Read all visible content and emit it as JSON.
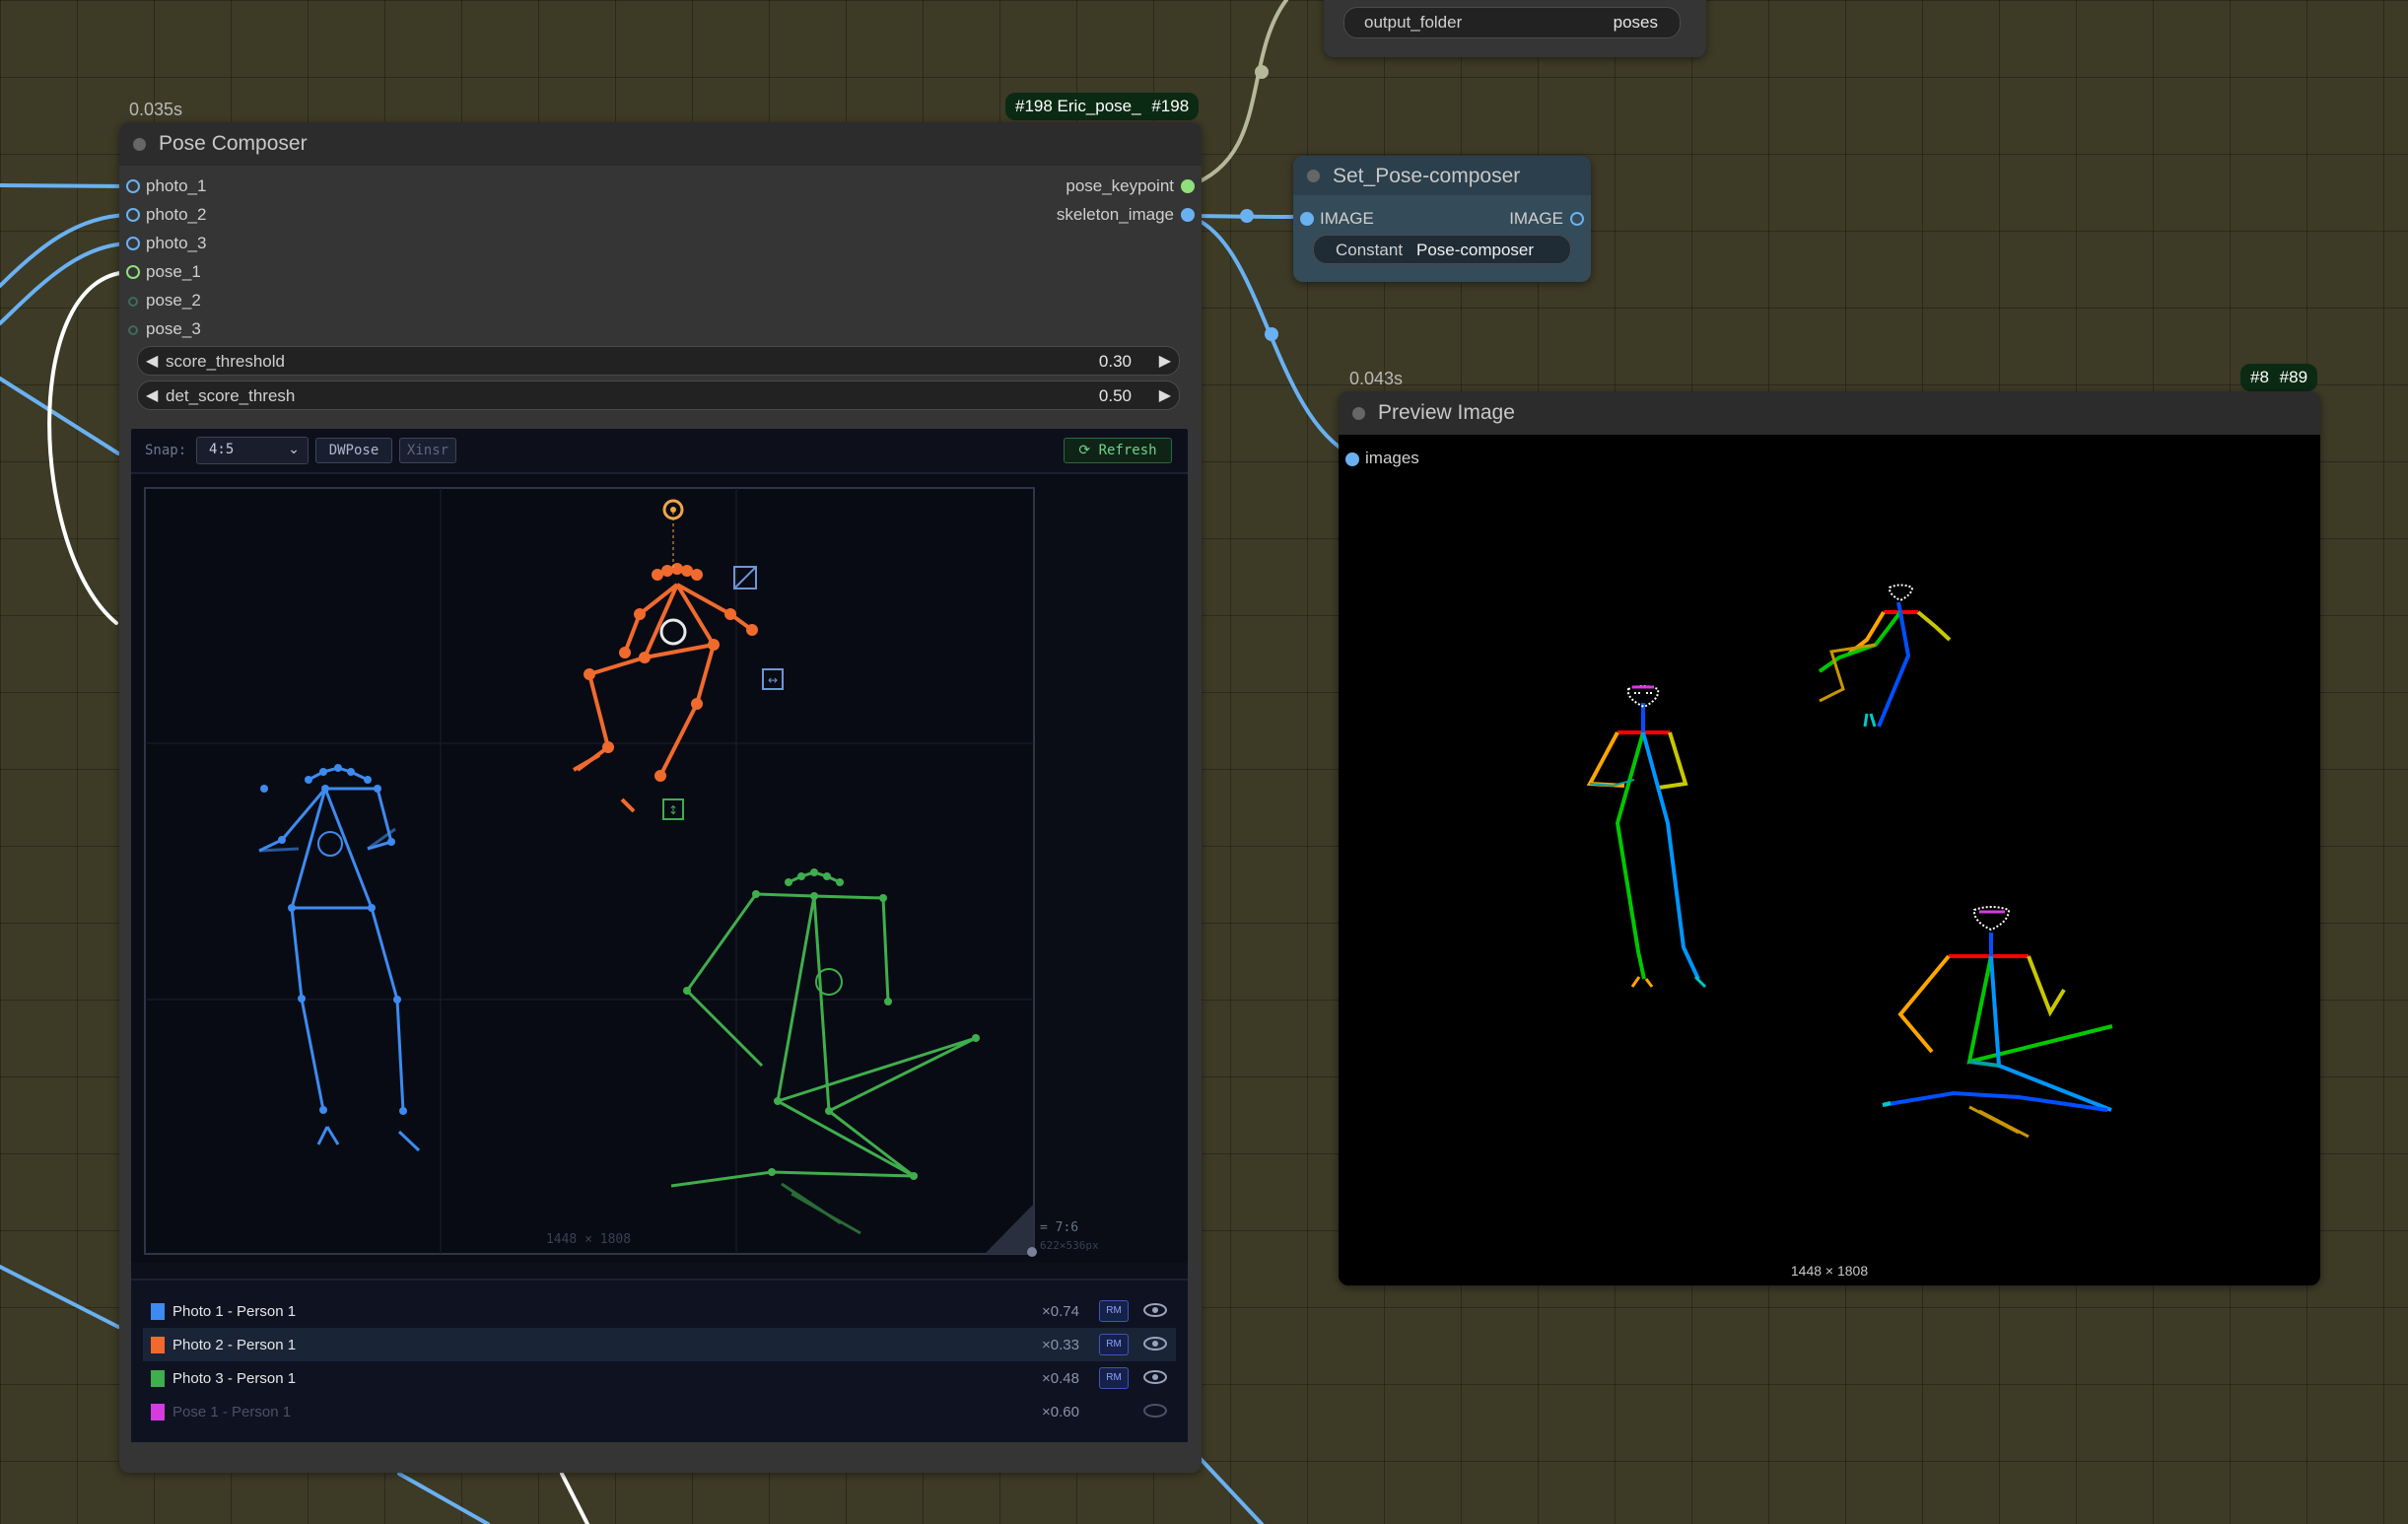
{
  "top_node": {
    "widget_label": "output_folder",
    "widget_value": "poses"
  },
  "pose_composer": {
    "timing": "0.035s",
    "badge_left": "#198 Eric_pose_",
    "badge_right": "#198",
    "title": "Pose Composer",
    "inputs": [
      "photo_1",
      "photo_2",
      "photo_3",
      "pose_1",
      "pose_2",
      "pose_3"
    ],
    "outputs": [
      "pose_keypoint",
      "skeleton_image"
    ],
    "widgets": [
      {
        "label": "score_threshold",
        "value": "0.30"
      },
      {
        "label": "det_score_thresh",
        "value": "0.50"
      }
    ],
    "toolbar": {
      "snap_label": "Snap:",
      "snap_value": "4:5",
      "dwpose_label": "DWPose",
      "xinsr_label": "Xinsr",
      "refresh_label": "⟳ Refresh"
    },
    "canvas": {
      "dimension_label": "1448 × 1808",
      "ratio_label": "= 7:6",
      "size_label": "622×536px"
    },
    "layers": [
      {
        "name": "Photo 1 - Person 1",
        "scale": "×0.74",
        "color": "#3d8bf0",
        "visible": true,
        "rm": "RM"
      },
      {
        "name": "Photo 2 - Person 1",
        "scale": "×0.33",
        "color": "#f06a2e",
        "visible": true,
        "rm": "RM",
        "selected": true
      },
      {
        "name": "Photo 3 - Person 1",
        "scale": "×0.48",
        "color": "#3fae4c",
        "visible": true,
        "rm": "RM"
      },
      {
        "name": "Pose 1 - Person 1",
        "scale": "×0.60",
        "color": "#d63be0",
        "visible": false
      }
    ]
  },
  "set_node": {
    "title": "Set_Pose-composer",
    "input_label": "IMAGE",
    "output_label": "IMAGE",
    "constant_label": "Constant",
    "constant_value": "Pose-composer"
  },
  "preview_node": {
    "timing": "0.043s",
    "badge_left": "#8",
    "badge_right": "#89",
    "title": "Preview Image",
    "input_label": "images",
    "dimension_label": "1448 × 1808"
  },
  "colors": {
    "background": "#3d3a26",
    "node": "#353535",
    "link_blue": "#6ab1f1",
    "link_white": "#ffffff",
    "link_gray": "#b6b89a",
    "canvas_bg": "#0a0c16"
  }
}
